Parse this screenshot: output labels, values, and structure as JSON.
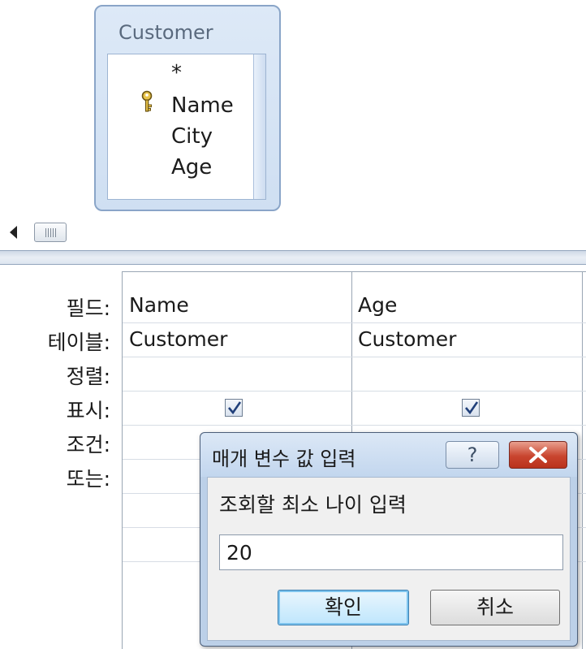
{
  "table_pane": {
    "table_name": "Customer",
    "fields": [
      "*",
      "Name",
      "City",
      "Age"
    ],
    "key_field": "Name"
  },
  "grid": {
    "row_labels": {
      "field": "필드:",
      "table": "테이블:",
      "sort": "정렬:",
      "show": "표시:",
      "criteria": "조건:",
      "or": "또는:"
    },
    "columns": [
      {
        "field": "Name",
        "table": "Customer",
        "show": true
      },
      {
        "field": "Age",
        "table": "Customer",
        "show": true
      }
    ]
  },
  "dialog": {
    "title": "매개 변수 값 입력",
    "help_label": "?",
    "prompt": "조회할 최소 나이 입력",
    "value": "20",
    "ok_label": "확인",
    "cancel_label": "취소"
  },
  "colors": {
    "table_border": "#8aa5c8",
    "dialog_frame": "#bcd0e8",
    "close_button": "#c9452f",
    "ok_highlight": "#7ec4ee"
  }
}
